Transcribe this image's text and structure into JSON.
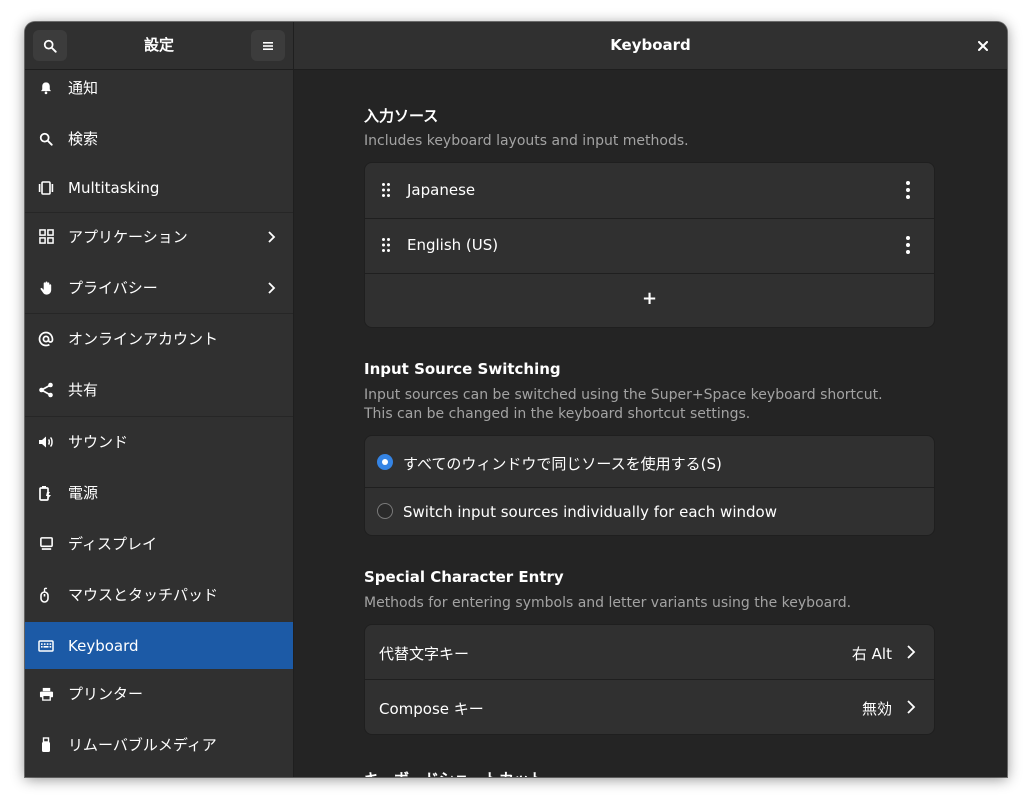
{
  "sidebar": {
    "title": "設定",
    "search_icon": "search-icon",
    "menu_icon": "hamburger-menu-icon",
    "items": [
      {
        "label": "通知",
        "icon": "bell-icon"
      },
      {
        "label": "検索",
        "icon": "search-icon"
      },
      {
        "label": "Multitasking",
        "icon": "multitasking-icon"
      },
      {
        "label": "アプリケーション",
        "icon": "apps-grid-icon",
        "has_chevron": true
      },
      {
        "label": "プライバシー",
        "icon": "hand-icon",
        "has_chevron": true
      },
      {
        "label": "オンラインアカウント",
        "icon": "at-icon"
      },
      {
        "label": "共有",
        "icon": "share-icon"
      },
      {
        "label": "サウンド",
        "icon": "speaker-icon"
      },
      {
        "label": "電源",
        "icon": "battery-icon"
      },
      {
        "label": "ディスプレイ",
        "icon": "monitor-icon"
      },
      {
        "label": "マウスとタッチパッド",
        "icon": "mouse-icon"
      },
      {
        "label": "Keyboard",
        "icon": "keyboard-icon",
        "active": true
      },
      {
        "label": "プリンター",
        "icon": "printer-icon"
      },
      {
        "label": "リムーバブルメディア",
        "icon": "usb-icon"
      }
    ]
  },
  "header": {
    "title": "Keyboard",
    "close_icon": "close-icon"
  },
  "input_sources": {
    "title": "入力ソース",
    "description": "Includes keyboard layouts and input methods.",
    "sources": [
      {
        "label": "Japanese"
      },
      {
        "label": "English (US)"
      }
    ],
    "add_label": "+"
  },
  "switching": {
    "title": "Input Source Switching",
    "description_1": "Input sources can be switched using the Super+Space keyboard shortcut.",
    "description_2": "This can be changed in the keyboard shortcut settings.",
    "option_same": "すべてのウィンドウで同じソースを使用する(S)",
    "option_individual": "Switch input sources individually for each window",
    "selected": "option_same"
  },
  "special": {
    "title": "Special Character Entry",
    "description": "Methods for entering symbols and letter variants using the keyboard.",
    "rows": [
      {
        "label": "代替文字キー",
        "value": "右 Alt"
      },
      {
        "label": "Compose キー",
        "value": "無効"
      }
    ]
  },
  "shortcuts": {
    "title": "キーボードショートカット"
  },
  "colors": {
    "accent": "#3584e4",
    "active_row": "#1c5aa6"
  }
}
